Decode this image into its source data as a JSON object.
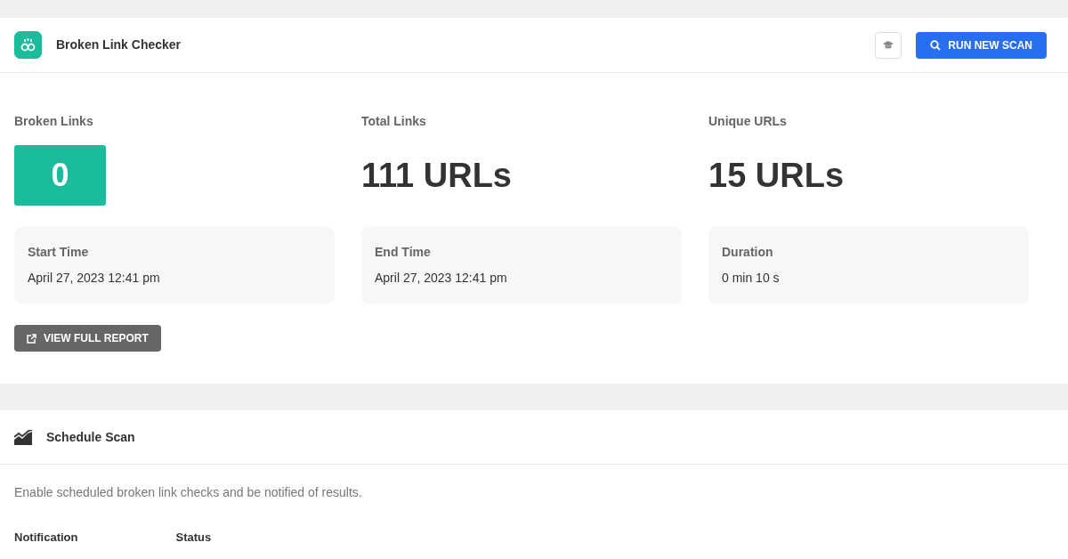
{
  "header": {
    "title": "Broken Link Checker",
    "run_button": "RUN NEW SCAN"
  },
  "stats": [
    {
      "kind": "badge",
      "label": "Broken Links",
      "value": "0"
    },
    {
      "kind": "plain",
      "label": "Total Links",
      "value": "111 URLs"
    },
    {
      "kind": "plain",
      "label": "Unique URLs",
      "value": "15 URLs"
    }
  ],
  "times": [
    {
      "label": "Start Time",
      "value": "April 27, 2023 12:41 pm"
    },
    {
      "label": "End Time",
      "value": "April 27, 2023 12:41 pm"
    },
    {
      "label": "Duration",
      "value": "0 min 10 s"
    }
  ],
  "report_button": "VIEW FULL REPORT",
  "schedule": {
    "title": "Schedule Scan",
    "description": "Enable scheduled broken link checks and be notified of results.",
    "labels": [
      "Notification",
      "Status"
    ]
  }
}
